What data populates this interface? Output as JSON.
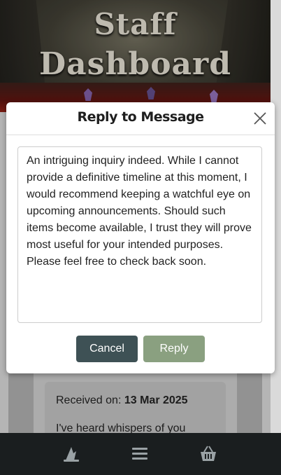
{
  "hero": {
    "title_line1": "Staff",
    "title_line2": "Dashboard"
  },
  "modal": {
    "title": "Reply to Message",
    "close_icon": "close-icon",
    "reply_text": "An intriguing inquiry indeed. While I cannot provide a definitive timeline at this moment, I would recommend keeping a watchful eye on upcoming announcements. Should such items become available, I trust they will prove most useful for your intended purposes. Please feel free to check back soon.",
    "cancel_label": "Cancel",
    "reply_label": "Reply"
  },
  "message": {
    "received_label": "Received on:",
    "received_date": "13 Mar 2025",
    "preview": "I've heard whispers of you"
  },
  "nav": {
    "icons": [
      "wizard-hat-icon",
      "menu-icon",
      "basket-icon"
    ]
  },
  "colors": {
    "cancel": "#3e5155",
    "reply": "#8aa080",
    "nav_bg": "#1a1e1f"
  }
}
